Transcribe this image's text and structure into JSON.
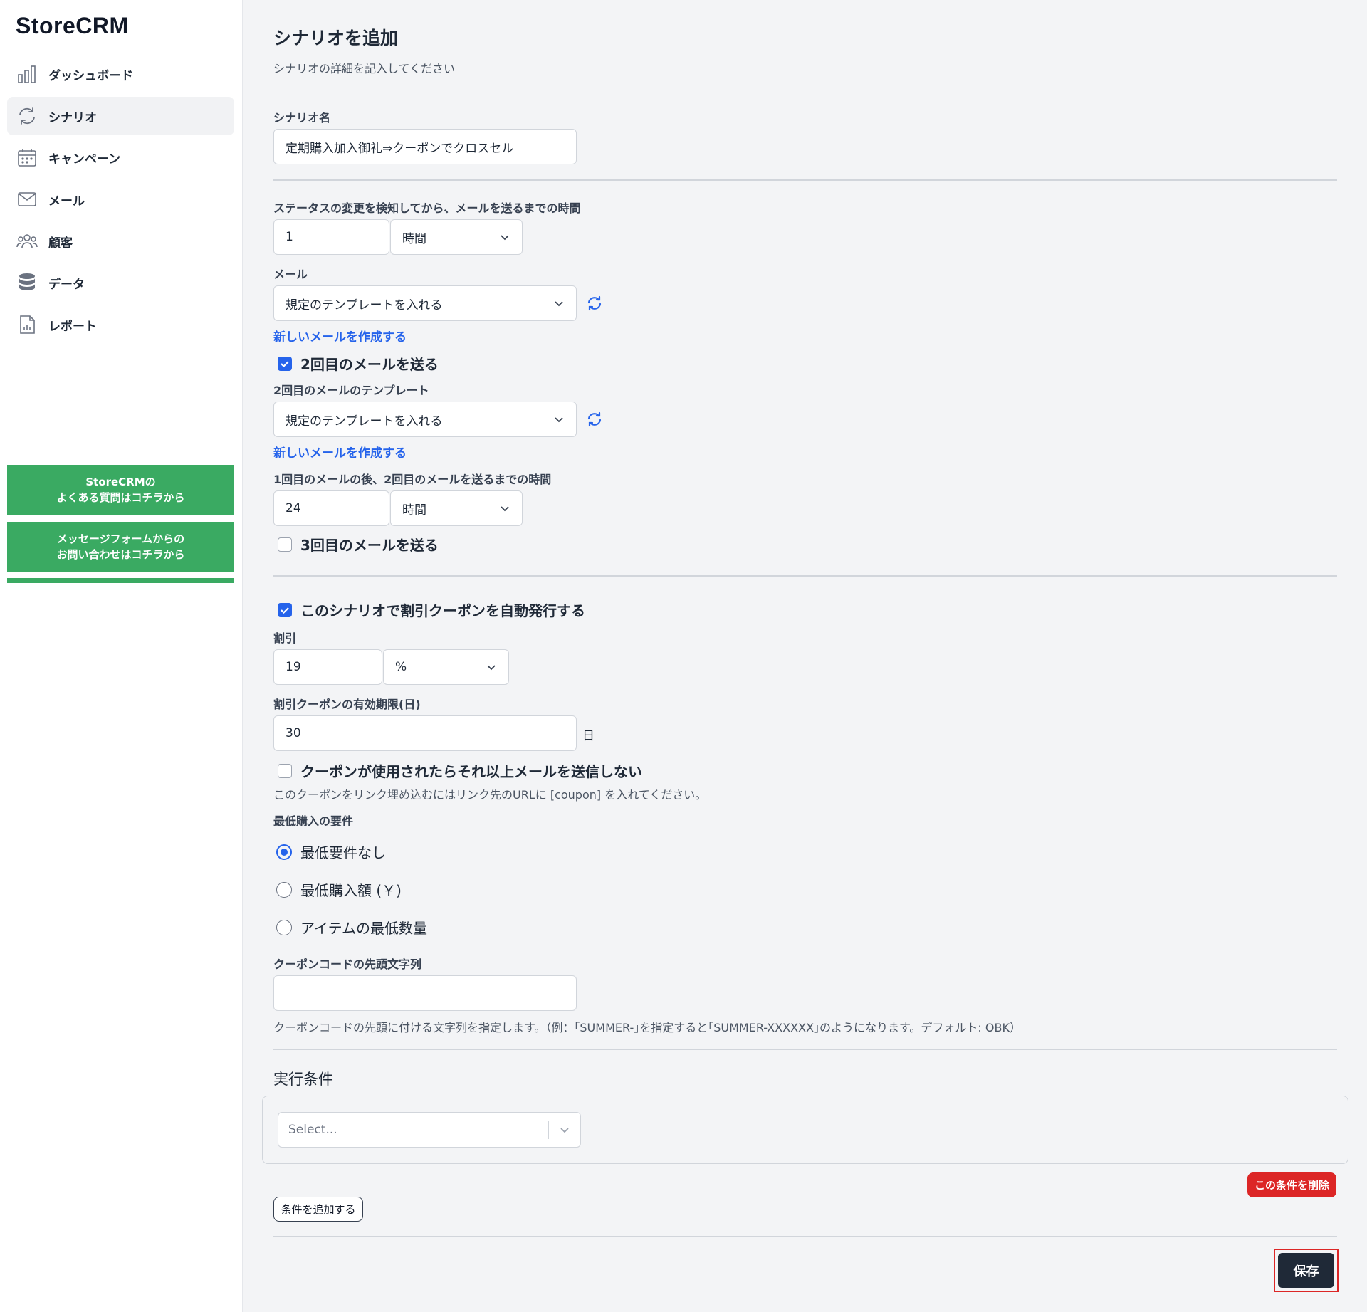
{
  "app": {
    "name": "StoreCRM"
  },
  "sidebar": {
    "items": [
      {
        "label": "ダッシュボード",
        "icon": "bar-chart-icon"
      },
      {
        "label": "シナリオ",
        "icon": "refresh-icon",
        "active": true
      },
      {
        "label": "キャンペーン",
        "icon": "calendar-icon"
      },
      {
        "label": "メール",
        "icon": "mail-icon"
      },
      {
        "label": "顧客",
        "icon": "users-icon"
      },
      {
        "label": "データ",
        "icon": "database-icon"
      },
      {
        "label": "レポート",
        "icon": "report-icon"
      }
    ],
    "faq_button": "StoreCRMの\nよくある質問はコチラから",
    "contact_button": "メッセージフォームからの\nお問い合わせはコチラから"
  },
  "form": {
    "title": "シナリオを追加",
    "subtitle": "シナリオの詳細を記入してください",
    "scenario_name_label": "シナリオ名",
    "scenario_name_value": "定期購入加入御礼⇒クーポンでクロスセル",
    "delay_label": "ステータスの変更を検知してから、メールを送るまでの時間",
    "delay_value": "1",
    "delay_unit": "時間",
    "mail_label": "メール",
    "mail_template": "規定のテンプレートを入れる",
    "new_mail_link": "新しいメールを作成する",
    "second_mail_checkbox": "2回目のメールを送る",
    "second_mail_checked": true,
    "second_template_label": "2回目のメールのテンプレート",
    "second_template": "規定のテンプレートを入れる",
    "second_new_mail_link": "新しいメールを作成する",
    "second_delay_label": "1回目のメールの後、2回目のメールを送るまでの時間",
    "second_delay_value": "24",
    "second_delay_unit": "時間",
    "third_mail_checkbox": "3回目のメールを送る",
    "third_mail_checked": false,
    "coupon_checkbox": "このシナリオで割引クーポンを自動発行する",
    "coupon_checked": true,
    "discount_label": "割引",
    "discount_value": "19",
    "discount_unit": "%",
    "validity_label": "割引クーポンの有効期限(日)",
    "validity_value": "30",
    "validity_suffix": "日",
    "stop_checkbox": "クーポンが使用されたらそれ以上メールを送信しない",
    "stop_checked": false,
    "coupon_link_hint": "このクーポンをリンク埋め込むにはリンク先のURLに [coupon] を入れてください。",
    "min_requirement_label": "最低購入の要件",
    "min_options": [
      "最低要件なし",
      "最低購入額 (￥)",
      "アイテムの最低数量"
    ],
    "min_selected": 0,
    "prefix_label": "クーポンコードの先頭文字列",
    "prefix_value": "",
    "prefix_hint": "クーポンコードの先頭に付ける文字列を指定します。（例：｢SUMMER-｣を指定すると｢SUMMER-XXXXXX｣のようになります。デフォルト: OBK）",
    "conditions_title": "実行条件",
    "condition_select_placeholder": "Select...",
    "delete_condition": "この条件を削除",
    "add_condition": "条件を追加する",
    "save": "保存"
  },
  "colors": {
    "accent": "#2563eb",
    "brand_green": "#3aaa62",
    "danger": "#dc2626",
    "save_bg": "#1f2937"
  }
}
